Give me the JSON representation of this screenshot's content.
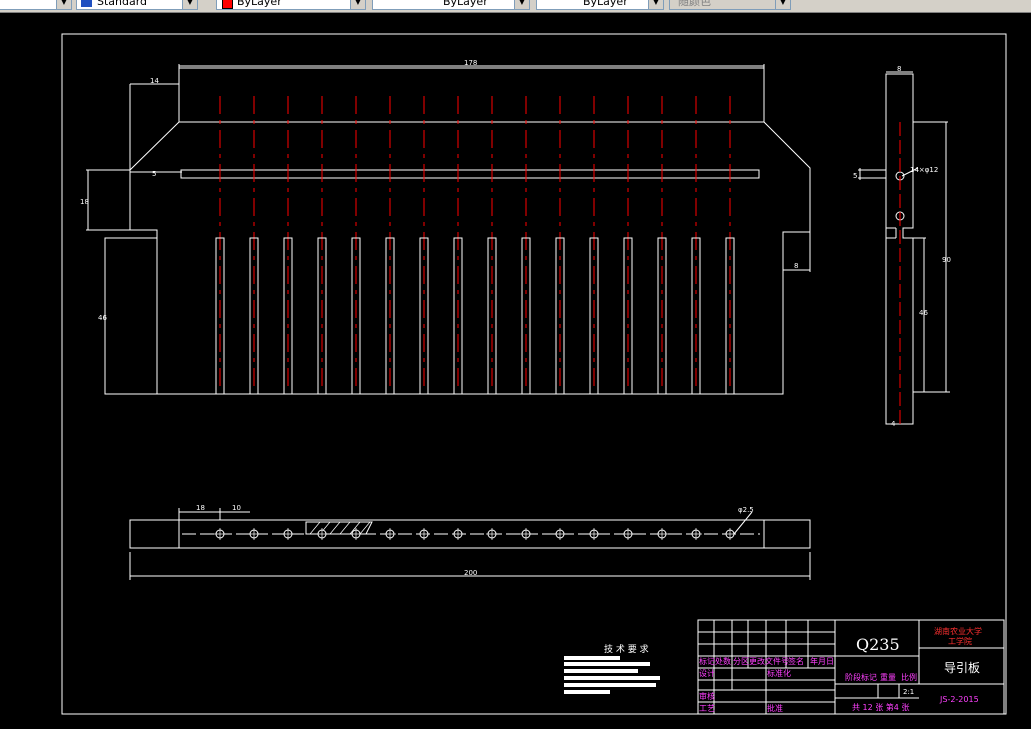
{
  "toolbar": {
    "textstyle": "Standard",
    "color": "ByLayer",
    "linetype": "ByLayer",
    "lineweight": "ByLayer",
    "plotstyle": "随颜色",
    "accent_red": "#ff0000"
  },
  "drawing": {
    "dims": {
      "top_length": "178",
      "left_step": "14",
      "slot_w": "5",
      "left_h": "18",
      "body_h": "46",
      "right_notch": "8",
      "side_top": "8",
      "side_small": "5",
      "side_total": "90",
      "side_lower": "46",
      "side_bottom": "4",
      "hole_callout": "14×φ12",
      "bottom_pitch1": "18",
      "bottom_pitch2": "10",
      "bottom_length": "200",
      "hole_diam": "φ2.5"
    },
    "tech_title": "技 术 要 求",
    "title_block": {
      "material": "Q235",
      "school": "湖南农业大学",
      "school_sub": "工学院",
      "part_name": "导引板",
      "drawing_no": "JS-2-2015",
      "scale": "2:1",
      "sheets": "共 12 张  第4 张",
      "r1": [
        "标记",
        "处数",
        "分区",
        "更改文件号",
        "签名",
        "年月日"
      ],
      "r2": [
        "设计",
        "",
        "标准化",
        "",
        "阶段标记",
        "重量",
        "比例"
      ],
      "r3": [
        "审核"
      ],
      "r4": [
        "工艺",
        "",
        "批准"
      ]
    }
  }
}
